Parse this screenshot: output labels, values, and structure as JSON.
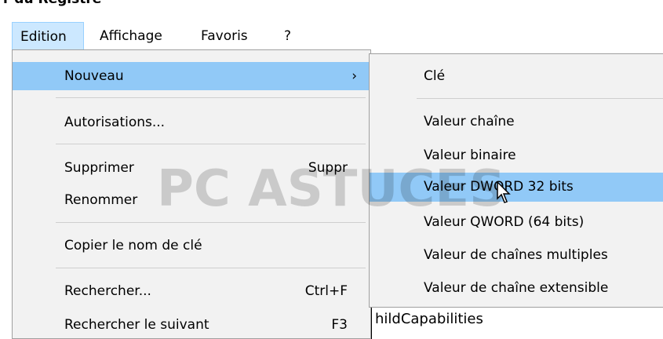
{
  "window": {
    "title": "r du Registre"
  },
  "menubar": {
    "items": [
      "Edition",
      "Affichage",
      "Favoris",
      "?"
    ]
  },
  "edit_menu": {
    "items": [
      {
        "label": "Nouveau",
        "accel": "›"
      },
      {
        "label": "Autorisations...",
        "accel": ""
      },
      {
        "label": "Supprimer",
        "accel": "Suppr"
      },
      {
        "label": "Renommer",
        "accel": ""
      },
      {
        "label": "Copier le nom de clé",
        "accel": ""
      },
      {
        "label": "Rechercher...",
        "accel": "Ctrl+F"
      },
      {
        "label": "Rechercher le suivant",
        "accel": "F3"
      }
    ]
  },
  "new_submenu": {
    "items": [
      "Clé",
      "Valeur chaîne",
      "Valeur binaire",
      "Valeur DWORD 32 bits",
      "Valeur QWORD (64 bits)",
      "Valeur de chaînes multiples",
      "Valeur de chaîne extensible"
    ]
  },
  "background": {
    "pane_text": "hildCapabilities"
  },
  "watermark": {
    "text": "PC ASTUCES"
  },
  "colors": {
    "highlight": "#91c9f7",
    "menu_bg": "#f2f2f2",
    "menubar_open": "#cce8ff"
  }
}
